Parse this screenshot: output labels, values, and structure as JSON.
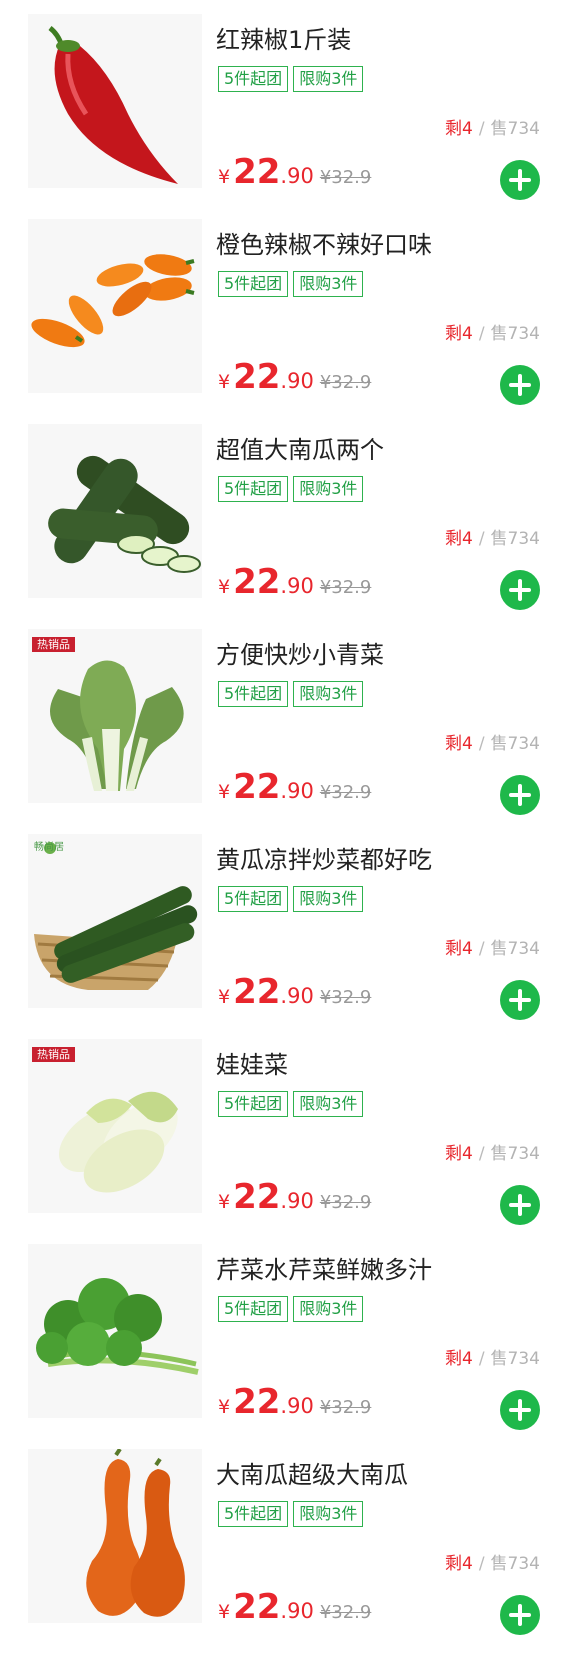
{
  "colors": {
    "accent_green": "#1eb84a",
    "price_red": "#e8262d",
    "tag_green": "#2eb24e",
    "muted_gray": "#b3b3b3"
  },
  "products": [
    {
      "name": "红辣椒1斤装",
      "image_icon": "red-pepper-image",
      "badge": "",
      "brand": "",
      "tag_group": "5件起团",
      "tag_limit": "限购3件",
      "remain": "剩4",
      "sep": "/",
      "sold": "售734",
      "currency": "¥",
      "price_int": "22",
      "price_dec": ".90",
      "orig_price": "¥32.9"
    },
    {
      "name": "橙色辣椒不辣好口味",
      "image_icon": "orange-peppers-image",
      "badge": "",
      "brand": "",
      "tag_group": "5件起团",
      "tag_limit": "限购3件",
      "remain": "剩4",
      "sep": "/",
      "sold": "售734",
      "currency": "¥",
      "price_int": "22",
      "price_dec": ".90",
      "orig_price": "¥32.9"
    },
    {
      "name": "超值大南瓜两个",
      "image_icon": "zucchini-image",
      "badge": "",
      "brand": "",
      "tag_group": "5件起团",
      "tag_limit": "限购3件",
      "remain": "剩4",
      "sep": "/",
      "sold": "售734",
      "currency": "¥",
      "price_int": "22",
      "price_dec": ".90",
      "orig_price": "¥32.9"
    },
    {
      "name": "方便快炒小青菜",
      "image_icon": "bok-choy-image",
      "badge": "热销品",
      "brand": "",
      "tag_group": "5件起团",
      "tag_limit": "限购3件",
      "remain": "剩4",
      "sep": "/",
      "sold": "售734",
      "currency": "¥",
      "price_int": "22",
      "price_dec": ".90",
      "orig_price": "¥32.9"
    },
    {
      "name": "黄瓜凉拌炒菜都好吃",
      "image_icon": "cucumber-basket-image",
      "badge": "",
      "brand": "畅尚居",
      "tag_group": "5件起团",
      "tag_limit": "限购3件",
      "remain": "剩4",
      "sep": "/",
      "sold": "售734",
      "currency": "¥",
      "price_int": "22",
      "price_dec": ".90",
      "orig_price": "¥32.9"
    },
    {
      "name": "娃娃菜",
      "image_icon": "baby-cabbage-image",
      "badge": "热销品",
      "brand": "",
      "tag_group": "5件起团",
      "tag_limit": "限购3件",
      "remain": "剩4",
      "sep": "/",
      "sold": "售734",
      "currency": "¥",
      "price_int": "22",
      "price_dec": ".90",
      "orig_price": "¥32.9"
    },
    {
      "name": "芹菜水芹菜鲜嫩多汁",
      "image_icon": "celery-image",
      "badge": "",
      "brand": "",
      "tag_group": "5件起团",
      "tag_limit": "限购3件",
      "remain": "剩4",
      "sep": "/",
      "sold": "售734",
      "currency": "¥",
      "price_int": "22",
      "price_dec": ".90",
      "orig_price": "¥32.9"
    },
    {
      "name": "大南瓜超级大南瓜",
      "image_icon": "long-pumpkin-image",
      "badge": "",
      "brand": "",
      "tag_group": "5件起团",
      "tag_limit": "限购3件",
      "remain": "剩4",
      "sep": "/",
      "sold": "售734",
      "currency": "¥",
      "price_int": "22",
      "price_dec": ".90",
      "orig_price": "¥32.9"
    }
  ]
}
